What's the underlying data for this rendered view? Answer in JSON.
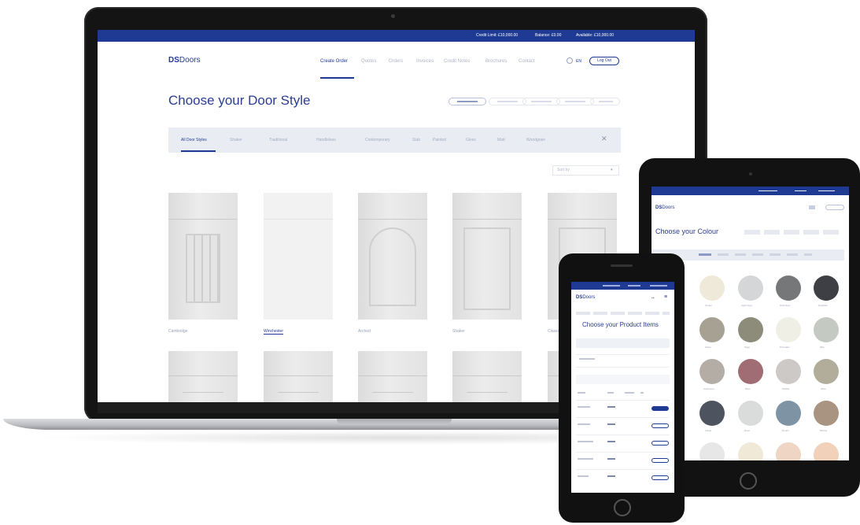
{
  "laptop": {
    "topbar": [
      "Credit Limit: £10,000.00",
      "Balance: £0.00",
      "Available: £10,000.00"
    ],
    "logo": {
      "mark": "DS",
      "text": "Doors"
    },
    "nav": [
      "Create Order",
      "Quotes",
      "Orders",
      "Invoices",
      "Credit Notes",
      "Brochures",
      "Contact"
    ],
    "lang": "EN",
    "logout": "Log Out",
    "title": "Choose your Door Style",
    "filters": [
      "All Door Styles",
      "Shaker",
      "Traditional",
      "Handleless",
      "Contemporary",
      "Slab",
      "Painted",
      "Gloss",
      "Matt",
      "Woodgrain"
    ],
    "sort_placeholder": "Sort by",
    "door_labels": [
      "Cambridge",
      "Winchester",
      "Arched",
      "Shaker",
      "Classic"
    ]
  },
  "tablet": {
    "logo": {
      "mark": "DS",
      "text": "Doors"
    },
    "title": "Choose your Colour",
    "swatch_colors": [
      "#efe9d9",
      "#d5d6d8",
      "#767779",
      "#3e3f44",
      "#a7a193",
      "#8d8b79",
      "#efefe6",
      "#c4cac2",
      "#b3ada5",
      "#9f6d73",
      "#cdc9c6",
      "#b2ad9a",
      "#4d5460",
      "#dadcdc",
      "#7e93a4",
      "#a99381",
      "#e7e7e7",
      "#f1e9d8",
      "#efd5c3",
      "#f2d1bb"
    ],
    "swatch_labels": [
      "Cream",
      "Light Grey",
      "Dust Grey",
      "Graphite",
      "Stone",
      "Sage",
      "Porcelain",
      "Mist",
      "Cashmere",
      "Plum",
      "Pebble",
      "Olive",
      "Indigo",
      "Dove",
      "Denim",
      "Mocha"
    ]
  },
  "phone": {
    "logo": {
      "mark": "DS",
      "text": "Doors"
    },
    "title": "Choose your Product Items"
  }
}
